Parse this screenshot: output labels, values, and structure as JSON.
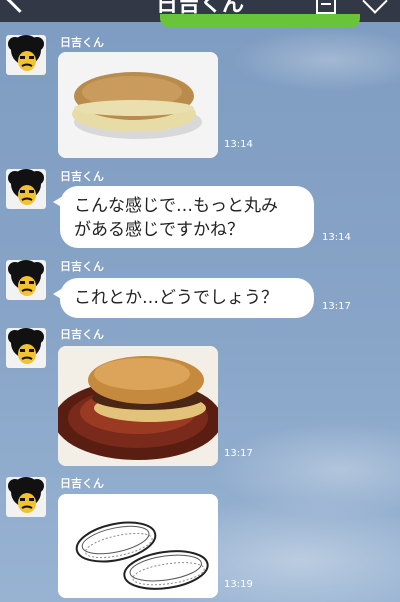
{
  "header": {
    "title": "日吉くん",
    "icons": [
      "back-icon",
      "note-icon",
      "heart-icon"
    ]
  },
  "messages": [
    {
      "sender": "日吉くん",
      "type": "image",
      "image": "dorayaki plain photo",
      "time": "13:14"
    },
    {
      "sender": "日吉くん",
      "type": "text",
      "line1": "こんな感じで…もっと丸み",
      "line2": "がある感じですかね？",
      "time": "13:14"
    },
    {
      "sender": "日吉くん",
      "type": "text",
      "line1": "これとか…どうでしょう？",
      "time": "13:17"
    },
    {
      "sender": "日吉くん",
      "type": "image",
      "image": "dorayaki on wooden plate photo",
      "time": "13:17"
    },
    {
      "sender": "日吉くん",
      "type": "image",
      "image": "dorayaki sketch drawing",
      "time": "13:19"
    }
  ],
  "colors": {
    "header_bg": "#323845",
    "chat_bg": "#88a5c8",
    "accent_green": "#69c43a"
  }
}
